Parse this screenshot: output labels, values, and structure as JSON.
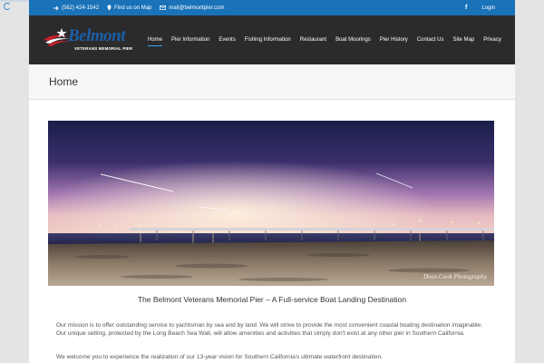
{
  "topbar": {
    "phone": "(562) 424-1542",
    "find": "Find us on Map",
    "email": "mail@belmontpier.com",
    "facebook": "f",
    "login": "Login"
  },
  "logo": {
    "name": "Belmont",
    "subtitle": "VETERANS MEMORIAL PIER"
  },
  "nav": {
    "items": [
      "Home",
      "Pier Information",
      "Events",
      "Fishing Information",
      "Restaurant",
      "Boat Moorings",
      "Pier History",
      "Contact Us",
      "Site Map",
      "Privacy"
    ]
  },
  "page": {
    "title": "Home"
  },
  "main": {
    "headline": "The Belmont Veterans Memorial Pier – A Full-service Boat Landing Destination",
    "paragraph1": "Our mission is to offer outstanding service to yachtsman by sea and by land. We will strive to provide the most convenient coastal boating destination imaginable. Our unique setting, protected by the Long Beach Sea Wall, will allow amenities and activities that simply don't exist at any other pier in Southern California.",
    "paragraph2": "We welcome you to experience the realization of our 13-year vision for Southern California's ultimate waterfront destination.",
    "photo_signature": "Dean Cook Photography"
  },
  "colors": {
    "topbar": "#1a72b8",
    "header": "#2b2b2b",
    "accent": "#2ea3f2"
  }
}
